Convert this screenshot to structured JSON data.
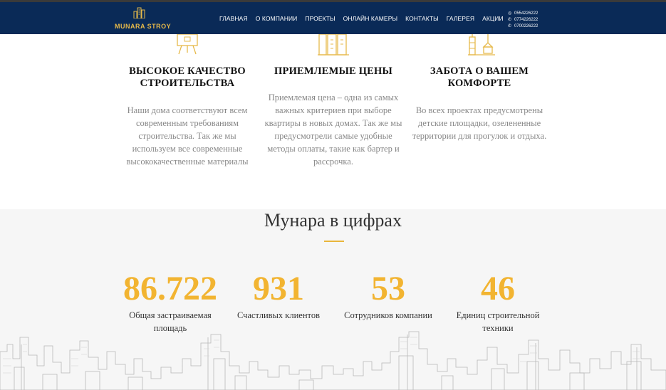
{
  "header": {
    "logo_text": "MUNARA STROY",
    "nav": [
      "ГЛАВНАЯ",
      "О КОМПАНИИ",
      "ПРОЕКТЫ",
      "ОНЛАЙН КАМЕРЫ",
      "КОНТАКТЫ",
      "ГАЛЕРЕЯ",
      "АКЦИИ"
    ],
    "phones": [
      "0554226222",
      "0774226222",
      "0700226222"
    ]
  },
  "features": [
    {
      "icon": "easel-icon",
      "title": "ВЫСОКОЕ КАЧЕСТВО СТРОИТЕЛЬСТВА",
      "text": "Наши дома соответствуют всем современным требованиям строительства. Так же мы используем все современные высококачественные материалы"
    },
    {
      "icon": "buildings-icon",
      "title": "ПРИЕМЛЕМЫЕ ЦЕНЫ",
      "text": "Приемлемая цена – одна из самых важных критериев при выборе квартиры в новых домах. Так же мы предусмотрели самые удобные методы оплаты, такие как бартер и рассрочка."
    },
    {
      "icon": "crane-icon",
      "title": "ЗАБОТА О ВАШЕМ КОМФОРТЕ",
      "text": "Во всех проектах предусмотрены детские площадки, озелененные территории для прогулок и отдыха."
    }
  ],
  "stats": {
    "title": "Мунара в цифрах",
    "items": [
      {
        "value": "86.722",
        "label": "Общая застраиваемая площадь"
      },
      {
        "value": "931",
        "label": "Счастливых клиентов"
      },
      {
        "value": "53",
        "label": "Сотрудников компании"
      },
      {
        "value": "46",
        "label": "Единиц строительной техники"
      }
    ]
  },
  "colors": {
    "header_bg": "#0a2a57",
    "accent": "#f2b431",
    "gold_icon": "#e6b94a"
  }
}
